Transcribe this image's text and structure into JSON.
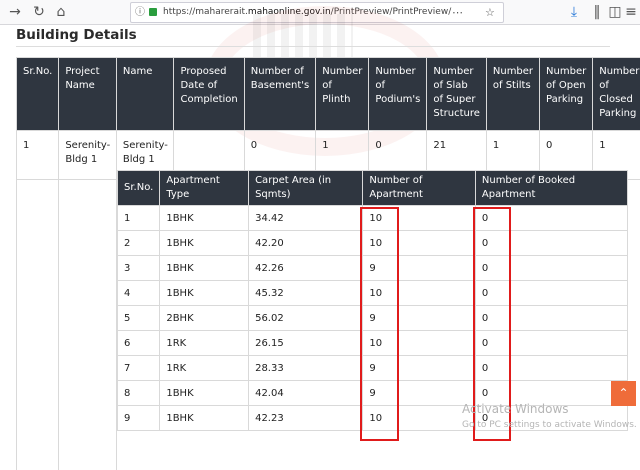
{
  "browser": {
    "url_prefix": "https://maharerait.",
    "url_domain": "mahaonline.gov.in",
    "url_path": "/PrintPreview/PrintPreview/"
  },
  "heading": "Building Details",
  "building_table": {
    "headers": [
      "Sr.No.",
      "Project Name",
      "Name",
      "Proposed Date of Completion",
      "Number of Basement's",
      "Number of Plinth",
      "Number of Podium's",
      "Number of Slab of Super Structure",
      "Number of Stilts",
      "Number of Open Parking",
      "Number of Closed Parking"
    ],
    "row": [
      "1",
      "Serenity-Bldg 1",
      "Serenity-Bldg 1",
      "",
      "0",
      "1",
      "0",
      "21",
      "1",
      "0",
      "1"
    ]
  },
  "apartment_table": {
    "headers": [
      "Sr.No.",
      "Apartment Type",
      "Carpet Area (in Sqmts)",
      "Number of Apartment",
      "Number of Booked Apartment"
    ],
    "rows": [
      [
        "1",
        "1BHK",
        "34.42",
        "10",
        "0"
      ],
      [
        "2",
        "1BHK",
        "42.20",
        "10",
        "0"
      ],
      [
        "3",
        "1BHK",
        "42.26",
        "9",
        "0"
      ],
      [
        "4",
        "1BHK",
        "45.32",
        "10",
        "0"
      ],
      [
        "5",
        "2BHK",
        "56.02",
        "9",
        "0"
      ],
      [
        "6",
        "1RK",
        "26.15",
        "10",
        "0"
      ],
      [
        "7",
        "1RK",
        "28.33",
        "9",
        "0"
      ],
      [
        "8",
        "1BHK",
        "42.04",
        "9",
        "0"
      ],
      [
        "9",
        "1BHK",
        "42.23",
        "10",
        "0"
      ]
    ]
  },
  "activate": {
    "title": "Activate Windows",
    "subtitle": "Go to PC settings to activate Windows."
  },
  "colors": {
    "header_bg": "#2f3640",
    "highlight": "#e01b1b",
    "scroll_top": "#ef6c3a"
  },
  "icons": [
    "forward-icon",
    "reload-icon",
    "home-icon",
    "site-info-icon",
    "lock-icon",
    "page-actions-icon",
    "bookmark-star-icon",
    "download-icon",
    "library-icon",
    "sidebar-icon",
    "menu-icon",
    "scroll-top-icon"
  ]
}
